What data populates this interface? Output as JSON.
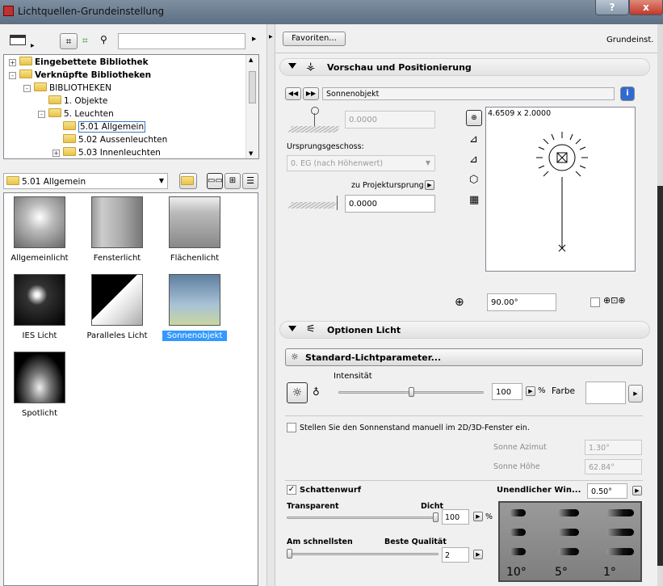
{
  "window": {
    "title": "Lichtquellen-Grundeinstellung",
    "help": "?",
    "close": "x"
  },
  "icons": {
    "app": "archicad-icon",
    "tree_view": "tree-view-icon",
    "library": "library-icon",
    "find": "search-icon",
    "help": "info-icon"
  },
  "left": {
    "search_value": "",
    "tree": [
      {
        "label": "Eingebettete Bibliothek",
        "bold": true,
        "indent": 0,
        "exp": "+"
      },
      {
        "label": "Verknüpfte Bibliotheken",
        "bold": true,
        "indent": 0,
        "exp": "-"
      },
      {
        "label": "BIBLIOTHEKEN",
        "bold": false,
        "indent": 1,
        "exp": "-"
      },
      {
        "label": "1. Objekte",
        "bold": false,
        "indent": 2,
        "exp": ""
      },
      {
        "label": "5. Leuchten",
        "bold": false,
        "indent": 2,
        "exp": "-"
      },
      {
        "label": "5.01 Allgemein",
        "bold": false,
        "indent": 3,
        "exp": "",
        "selected": true
      },
      {
        "label": "5.02 Aussenleuchten",
        "bold": false,
        "indent": 3,
        "exp": ""
      },
      {
        "label": "5.03 Innenleuchten",
        "bold": false,
        "indent": 3,
        "exp": "+"
      }
    ],
    "folder_select": "5.01 Allgemein",
    "thumbnails": [
      {
        "label": "Allgemeinlicht"
      },
      {
        "label": "Fensterlicht"
      },
      {
        "label": "Flächenlicht"
      },
      {
        "label": "IES Licht"
      },
      {
        "label": "Paralleles Licht"
      },
      {
        "label": "Sonnenobjekt",
        "selected": true
      },
      {
        "label": "Spotlicht"
      }
    ]
  },
  "right": {
    "favorites": "Favoriten...",
    "defaults": "Grundeinst.",
    "preview_section": "Vorschau und Positionierung",
    "object_name": "Sonnenobjekt",
    "elevation_value": "0.0000",
    "home_story_label": "Ursprungsgeschoss:",
    "home_story_value": "0. EG (nach Höhenwert)",
    "to_project_zero": "zu Projektursprung",
    "offset_value": "0.0000",
    "preview_size": "4.6509 x 2.0000",
    "rotation_value": "90.00°",
    "options_section": "Optionen Licht",
    "std_params": "Standard-Lichtparameter...",
    "intensity_label": "Intensität",
    "intensity_value": "100",
    "percent": "%",
    "color_label": "Farbe",
    "intensity_level": 0.5,
    "sun_manual_label": "Stellen Sie den Sonnenstand manuell im 2D/3D-Fenster ein.",
    "sun_azimuth_label": "Sonne Azimut",
    "sun_azimuth_value": "1.30°",
    "sun_height_label": "Sonne Höhe",
    "sun_height_value": "62.84°",
    "shadow_label": "Schattenwurf",
    "shadow_checked": "✓",
    "infinite_label": "Unendlicher Win...",
    "infinite_value": "0.50°",
    "transparent_label": "Transparent",
    "dense_label": "Dicht",
    "dense_value": "100",
    "dense_level": 1.0,
    "fastest_label": "Am schnellsten",
    "best_label": "Beste Qualität",
    "quality_value": "2",
    "quality_level": 0.0,
    "angle_labels": [
      "10°",
      "5°",
      "1°"
    ]
  }
}
